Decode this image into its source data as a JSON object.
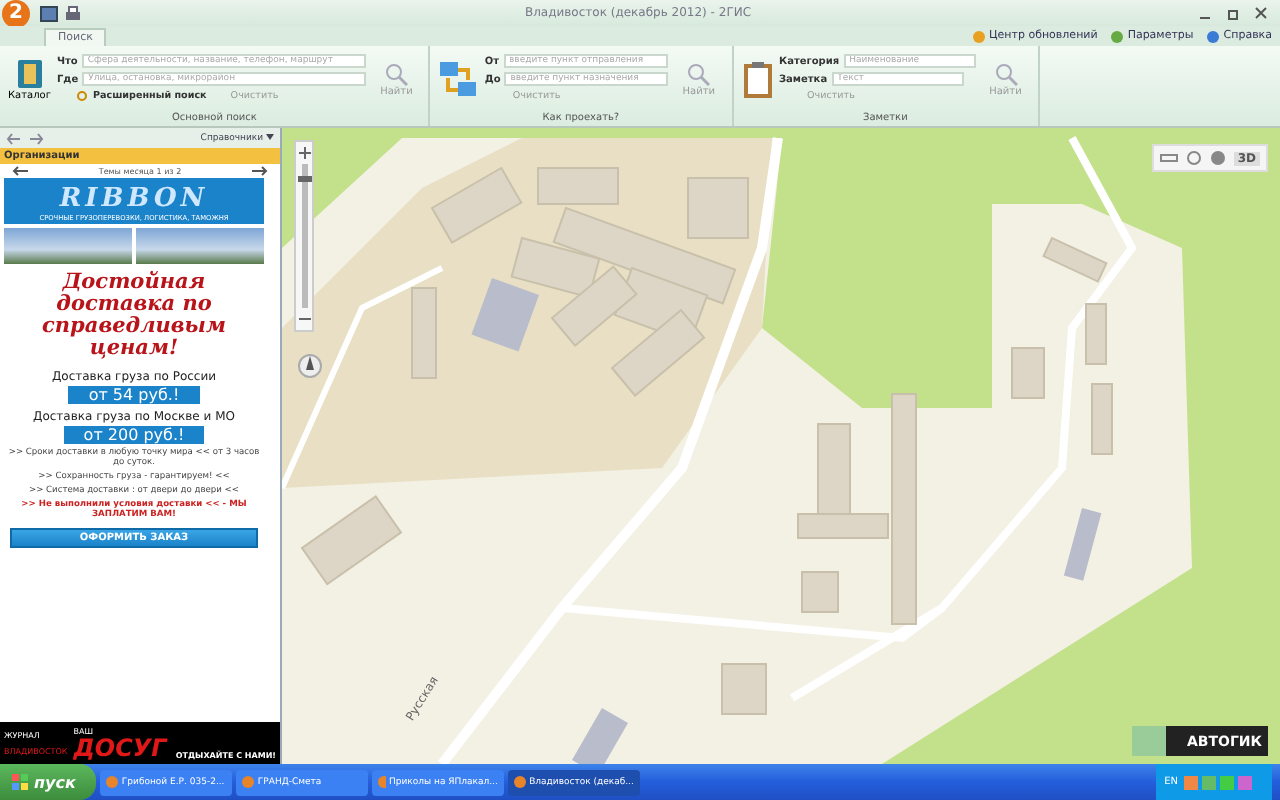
{
  "window": {
    "logo": "2",
    "title": "Владивосток (декабрь 2012) - 2ГИС"
  },
  "tabs": [
    {
      "label": "Поиск",
      "selected": true
    }
  ],
  "top_links": [
    "Центр обновлений",
    "Параметры",
    "Справка"
  ],
  "ribbon": {
    "main_search": {
      "catalog": "Каталог",
      "what_label": "Что",
      "what_placeholder": "Сфера деятельности, название, телефон, маршрут",
      "where_label": "Где",
      "where_placeholder": "Улица, остановка, микрорайон",
      "advanced": "Расширенный поиск",
      "clear": "Очистить",
      "find": "Найти",
      "caption": "Основной поиск"
    },
    "route": {
      "from_label": "От",
      "from_placeholder": "введите пункт отправления",
      "to_label": "До",
      "to_placeholder": "введите пункт назначения",
      "clear": "Очистить",
      "find": "Найти",
      "caption": "Как проехать?"
    },
    "notes": {
      "category_label": "Категория",
      "category_placeholder": "Наименование",
      "note_label": "Заметка",
      "note_placeholder": "Текст",
      "clear": "Очистить",
      "find": "Найти",
      "caption": "Заметки"
    }
  },
  "sidebar": {
    "dropdown": "Справочники",
    "section": "Организации",
    "pager": "Темы месяца 1 из 2",
    "ad": {
      "brand": "RIBBON",
      "slogan": "СРОЧНЫЕ ГРУЗОПЕРЕВОЗКИ, ЛОГИСТИКА, ТАМОЖНЯ",
      "headline": "Достойная доставка по справедливым ценам!",
      "offers": [
        {
          "label": "Доставка груза по России",
          "price": "от 54 руб.!"
        },
        {
          "label": "Доставка груза по Москве и МО",
          "price": "от 200 руб.!"
        }
      ],
      "points": [
        {
          "kind": "normal",
          "text": ">> Сроки доставки в любую точку мира << от 3 часов до суток."
        },
        {
          "kind": "normal",
          "text": ">> Сохранность груза - гарантируем! <<"
        },
        {
          "kind": "normal",
          "text": ">> Система доставки : от двери до двери <<"
        },
        {
          "kind": "alert",
          "text": ">> Не выполнили условия доставки << - МЫ ЗАПЛАТИМ ВАМ!"
        }
      ],
      "order_button": "ОФОРМИТЬ ЗАКАЗ"
    },
    "banner": {
      "small": "ЖУРНАЛ",
      "your": "ВАШ",
      "name": "ДОСУГ",
      "city": "ВЛАДИВОСТОК",
      "tagline": "ОТДЫХАЙТЕ С НАМИ!"
    }
  },
  "map": {
    "zoom": {
      "level": 0.9
    },
    "street": "Русская",
    "view_3d": "3D",
    "ad": "АВТОГИК"
  },
  "taskbar": {
    "start": "пуск",
    "items": [
      {
        "label": "Грибоной Е.Р. 035-2...",
        "selected": false
      },
      {
        "label": "ГРАНД-Смета",
        "selected": false
      },
      {
        "label": "Приколы на ЯПлакал...",
        "selected": false
      },
      {
        "label": "Владивосток (декаб...",
        "selected": true
      }
    ],
    "lang": "EN"
  }
}
